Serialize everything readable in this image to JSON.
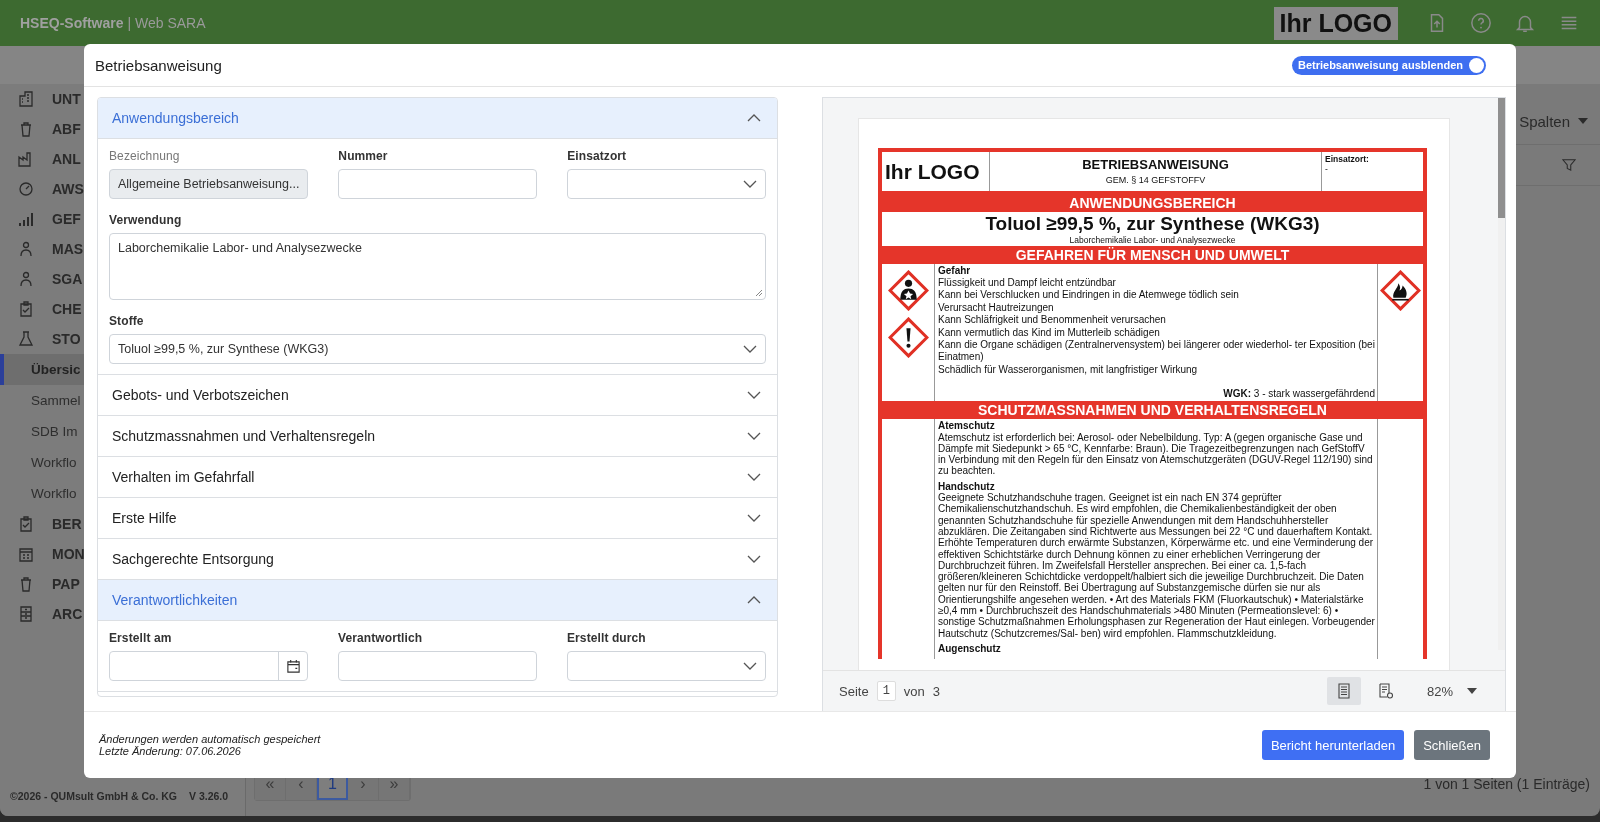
{
  "app_header": {
    "brand": "HSEQ-Software",
    "product": "| Web SARA",
    "logo": "Ihr LOGO"
  },
  "sidebar": {
    "items": [
      {
        "label": "UNT"
      },
      {
        "label": "ABF"
      },
      {
        "label": "ANL"
      },
      {
        "label": "AWS"
      },
      {
        "label": "GEF"
      },
      {
        "label": "MAS"
      },
      {
        "label": "SGA"
      },
      {
        "label": "CHE"
      },
      {
        "label": "STO",
        "children": [
          {
            "label": "Übersic",
            "selected": true
          },
          {
            "label": "Sammel",
            "selected": false
          },
          {
            "label": "SDB Im",
            "selected": false
          },
          {
            "label": "Workflo",
            "selected": false
          },
          {
            "label": "Workflo",
            "selected": false
          }
        ]
      },
      {
        "label": "BER"
      },
      {
        "label": "MON"
      },
      {
        "label": "PAP"
      },
      {
        "label": "ARC"
      }
    ],
    "footer": {
      "copyright": "©2026 - QUMsult GmbH & Co. KG",
      "version": "V 3.26.0"
    }
  },
  "toolbar": {
    "columns_button": "Spalten"
  },
  "pagination": {
    "pages": [
      {
        "label": "«",
        "selected": false,
        "disabled": true
      },
      {
        "label": "‹",
        "selected": false,
        "disabled": true
      },
      {
        "label": "1",
        "selected": true,
        "disabled": false
      },
      {
        "label": "›",
        "selected": false,
        "disabled": true
      },
      {
        "label": "»",
        "selected": false,
        "disabled": true
      }
    ],
    "status": "1 von 1 Seiten (1 Einträge)"
  },
  "modal": {
    "title": "Betriebsanweisung",
    "toggle": {
      "label": "Betriebsanweisung ausblenden",
      "on": true
    },
    "sections": [
      {
        "title": "Anwendungsbereich",
        "expanded": true,
        "rows": [
          [
            {
              "label": "Bezeichnung",
              "kind": "text",
              "value": "Allgemeine Betriebsanweisung...",
              "disabled": true
            },
            {
              "label": "Nummer",
              "kind": "text",
              "disabled": false
            },
            {
              "label": "Einsatzort",
              "kind": "select",
              "disabled": false
            }
          ],
          [
            {
              "label": "Verwendung",
              "kind": "textarea",
              "value": "Laborchemikalie Labor- und Analysezwecke",
              "disabled": false
            }
          ],
          [
            {
              "label": "Stoffe",
              "kind": "select",
              "value": "Toluol ≥99,5 %, zur Synthese (WKG3)",
              "disabled": false
            }
          ]
        ]
      },
      {
        "title": "Gebots- und Verbotszeichen",
        "expanded": false
      },
      {
        "title": "Schutzmassnahmen und Verhaltensregeln",
        "expanded": false
      },
      {
        "title": "Verhalten im Gefahrfall",
        "expanded": false
      },
      {
        "title": "Erste Hilfe",
        "expanded": false
      },
      {
        "title": "Sachgerechte Entsorgung",
        "expanded": false
      },
      {
        "title": "Verantwortlichkeiten",
        "expanded": true,
        "rows": [
          [
            {
              "label": "Erstellt am",
              "kind": "date",
              "disabled": false
            },
            {
              "label": "Verantwortlich",
              "kind": "text",
              "disabled": false
            },
            {
              "label": "Erstellt durch",
              "kind": "select",
              "disabled": false
            }
          ]
        ]
      }
    ],
    "viewer": {
      "document": {
        "logo": "Ihr LOGO",
        "title": "BETRIEBSANWEISUNG",
        "subtitle": "GEM. § 14 GEFSTOFFV",
        "location_label": "Einsatzort:",
        "location_value": "-",
        "sections": [
          {
            "kind": "application",
            "heading": "ANWENDUNGSBEREICH",
            "substance": "Toluol ≥99,5 %, zur Synthese (WKG3)",
            "usage": "Laborchemikalie Labor- und Analysezwecke"
          },
          {
            "kind": "hazards",
            "heading": "GEFAHREN FÜR MENSCH UND UMWELT",
            "signal_word": "Gefahr",
            "statements": [
              "Flüssigkeit und Dampf leicht entzündbar",
              "Kann bei Verschlucken und Eindringen in die Atemwege tödlich sein",
              "Verursacht Hautreizungen",
              "Kann Schläfrigkeit und Benommenheit verursachen",
              "Kann vermutlich das Kind im Mutterleib schädigen",
              "Kann die Organe schädigen (Zentralnervensystem) bei längerer oder wiederhol- ter Exposition (bei Einatmen)",
              "Schädlich für Wasserorganismen, mit langfristiger Wirkung"
            ],
            "wgk_label": "WGK:",
            "wgk_value": "3 - stark wassergefährdend"
          },
          {
            "kind": "measures",
            "heading": "SCHUTZMASSNAHMEN UND VERHALTENSREGELN",
            "paragraphs": [
              {
                "title": "Atemschutz",
                "text": "Atemschutz ist erforderlich bei: Aerosol- oder Nebelbildung. Typ: A (gegen organische Gase und Dämpfe mit Siedepunkt > 65 °C, Kennfarbe: Braun). Die Tragezeitbegrenzungen nach GefStoffV in Verbindung mit den Regeln für den Einsatz von Atemschutzgeräten (DGUV-Regel 112/190) sind zu beachten."
              },
              {
                "title": "Handschutz",
                "text": "Geeignete Schutzhandschuhe tragen. Geeignet ist ein nach EN 374 geprüfter Chemikalienschutzhandschuh. Es wird empfohlen, die Chemikalienbeständigkeit der oben genannten Schutzhandschuhe für spezielle Anwendungen mit dem Handschuhhersteller abzuklären. Die Zeitangaben sind Richtwerte aus Messungen bei 22 °C und dauerhaftem Kontakt. Erhöhte Temperaturen durch erwärmte Substanzen, Körperwärme etc. und eine Verminderung der effektiven Schichtstärke durch Dehnung können zu einer erheblichen Verringerung der Durchbruchzeit führen. Im Zweifelsfall Hersteller ansprechen. Bei einer ca. 1,5-fach größeren/kleineren Schichtdicke verdoppelt/halbiert sich die jeweilige Durchbruchzeit. Die Daten gelten nur für den Reinstoff. Bei Übertragung auf Substanzgemische dürfen sie nur als Orientierungshilfe angesehen werden. • Art des Materials FKM (Fluorkautschuk) • Materialstärke ≥0,4 mm • Durchbruchszeit des Handschuhmaterials >480 Minuten (Permeationslevel: 6) • sonstige Schutzmaßnahmen Erholungsphasen zur Regeneration der Haut einlegen. Vorbeugender Hautschutz (Schutzcremes/Sal- ben) wird empfohlen. Flammschutzkleidung."
              },
              {
                "title": "Augenschutz"
              }
            ]
          }
        ]
      },
      "page_label": "Seite",
      "page": "1",
      "page_of": "von",
      "page_count": "3",
      "zoom": "82%",
      "view_modes": [
        {
          "selected": true
        },
        {
          "selected": false
        }
      ]
    },
    "footer": {
      "note": "Änderungen werden automatisch gespeichert",
      "last_change": "Letzte Änderung: 07.06.2026"
    },
    "buttons": [
      {
        "label": "Bericht herunterladen",
        "kind": "primary"
      },
      {
        "label": "Schließen",
        "kind": "secondary"
      }
    ]
  }
}
